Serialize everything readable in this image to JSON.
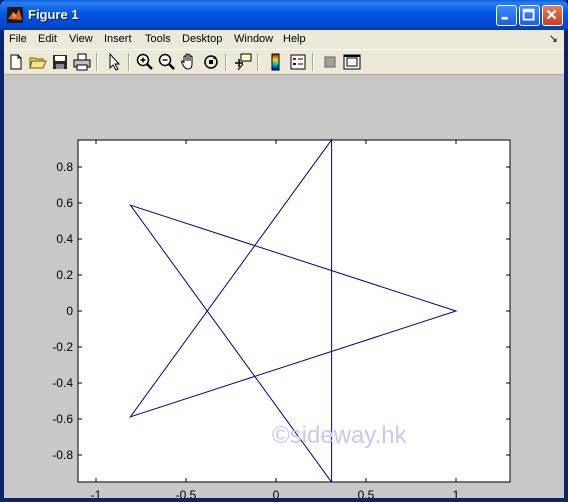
{
  "window": {
    "title": "Figure 1",
    "colors": {
      "titlebar": "#0055e5",
      "figure_bg": "#c8c8c8",
      "axes_bg": "#ffffff",
      "line": "#00008b"
    }
  },
  "menubar": {
    "items": [
      {
        "label": "File"
      },
      {
        "label": "Edit"
      },
      {
        "label": "View"
      },
      {
        "label": "Insert"
      },
      {
        "label": "Tools"
      },
      {
        "label": "Desktop"
      },
      {
        "label": "Window"
      },
      {
        "label": "Help"
      }
    ],
    "overflow_glyph": "↘"
  },
  "toolbar": {
    "buttons": [
      {
        "icon": "new-file-icon"
      },
      {
        "icon": "open-folder-icon"
      },
      {
        "icon": "save-icon"
      },
      {
        "icon": "print-icon"
      },
      {
        "icon": "edit-plot-arrow-icon"
      },
      {
        "icon": "zoom-in-icon"
      },
      {
        "icon": "zoom-out-icon"
      },
      {
        "icon": "pan-hand-icon"
      },
      {
        "icon": "rotate-3d-icon"
      },
      {
        "icon": "data-cursor-icon"
      },
      {
        "icon": "colorbar-icon"
      },
      {
        "icon": "legend-icon"
      },
      {
        "icon": "hide-plot-tools-icon"
      },
      {
        "icon": "show-plot-tools-icon"
      }
    ]
  },
  "watermark": "©sideway.hk",
  "chart_data": {
    "type": "line",
    "title": "",
    "xlabel": "",
    "ylabel": "",
    "xlim": [
      -1.1,
      1.3
    ],
    "ylim": [
      -0.95,
      0.95
    ],
    "grid": false,
    "xticks": [
      -1,
      -0.5,
      0,
      0.5,
      1
    ],
    "xtick_labels": [
      "-1",
      "-0.5",
      "0",
      "0.5",
      "1"
    ],
    "yticks": [
      -0.8,
      -0.6,
      -0.4,
      -0.2,
      0,
      0.2,
      0.4,
      0.6,
      0.8
    ],
    "ytick_labels": [
      "-0.8",
      "-0.6",
      "-0.4",
      "-0.2",
      "0",
      "0.2",
      "0.4",
      "0.6",
      "0.8"
    ],
    "series": [
      {
        "color": "#00008b",
        "x": [
          0.309,
          0.309,
          -0.809,
          1.0,
          -0.809,
          0.309
        ],
        "y": [
          -0.951,
          0.951,
          -0.588,
          0.0,
          0.588,
          -0.951
        ]
      }
    ]
  }
}
